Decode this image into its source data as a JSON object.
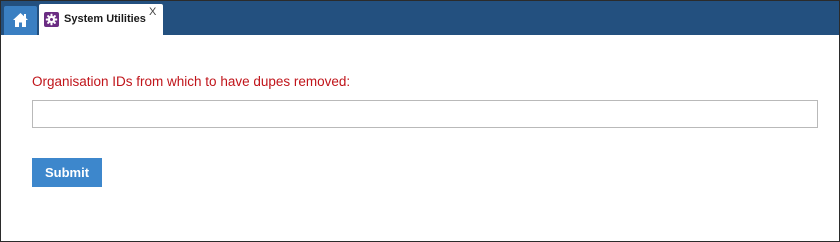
{
  "tabs": {
    "home_icon": "home-icon",
    "active": {
      "icon": "gear-icon",
      "label": "System Utilities",
      "close_label": "X"
    }
  },
  "form": {
    "field_label": "Organisation IDs from which to have dupes removed:",
    "input_value": "",
    "submit_label": "Submit"
  },
  "colors": {
    "tabbar": "#23507f",
    "home_tab": "#3a7fc2",
    "label_red": "#c0141a",
    "submit_blue": "#3d87cc",
    "tab_icon_purple": "#6b2d83"
  }
}
